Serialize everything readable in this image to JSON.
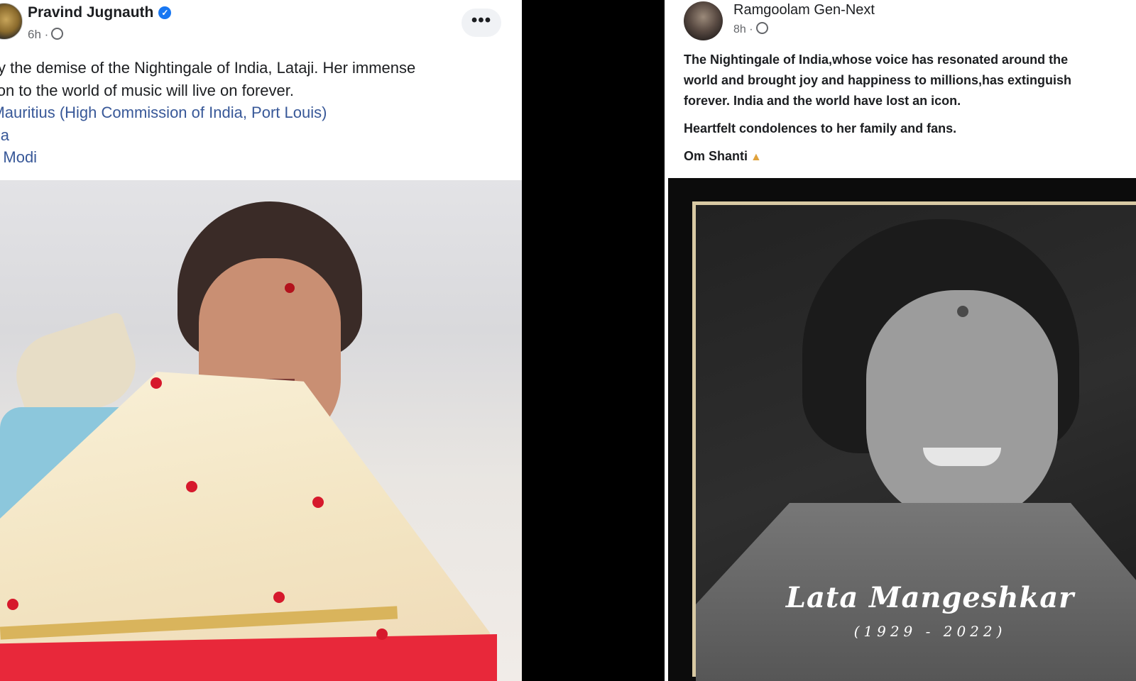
{
  "left_post": {
    "author": "Pravind Jugnauth",
    "time": "6h ·",
    "more_label": "•••",
    "text_line1": "ned by the demise of the Nightingale of India, Lataji. Her immense",
    "text_line2": "tribution to the world of music will live on forever.",
    "tags": [
      "ia in Mauritius (High Commission of India, Port Louis)",
      "O India",
      "endra Modi"
    ]
  },
  "right_post": {
    "author": "Ramgoolam Gen-Next",
    "time": "8h ·",
    "text_line1": "The Nightingale of India,whose voice has resonated around the",
    "text_line2": "world and brought joy and happiness to millions,has extinguish",
    "text_line3": "forever. India and the world have lost an icon.",
    "condolences": "Heartfelt condolences to her family and fans.",
    "om_shanti": "Om Shanti",
    "caption_name": "Lata Mangeshkar",
    "caption_years": "(1929 - 2022)"
  },
  "colors": {
    "link": "#385898",
    "verified": "#1877f2",
    "meta": "#65676b"
  }
}
